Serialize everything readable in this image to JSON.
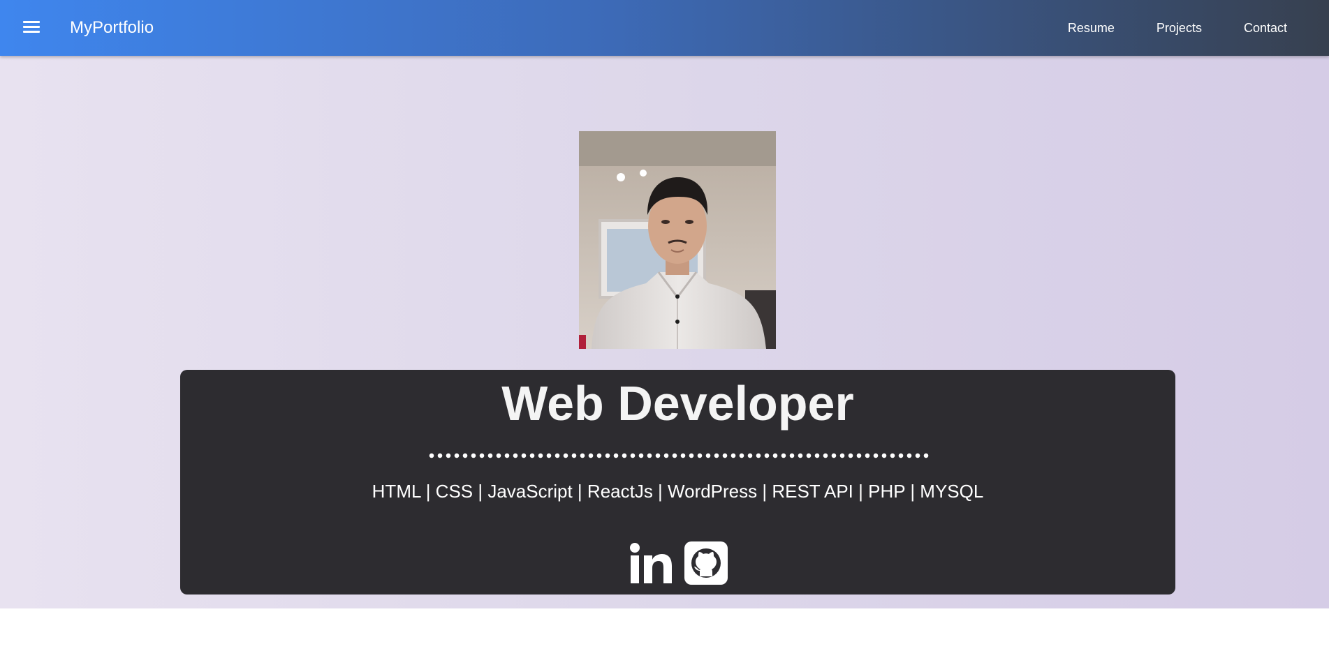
{
  "nav": {
    "menu_icon": "hamburger-menu-icon",
    "brand": "MyPortfolio",
    "links": [
      {
        "label": "Resume"
      },
      {
        "label": "Projects"
      },
      {
        "label": "Contact"
      }
    ]
  },
  "hero": {
    "title": "Web Developer",
    "skills": "HTML | CSS | JavaScript | ReactJs | WordPress | REST API | PHP | MYSQL",
    "social_links": [
      {
        "icon": "linkedin-icon"
      },
      {
        "icon": "github-icon"
      }
    ]
  },
  "colors": {
    "nav_gradient_start": "#3f86ee",
    "nav_gradient_end": "#37404f",
    "card_background": "#2d2c30",
    "hero_background": "#ddd7ea"
  }
}
